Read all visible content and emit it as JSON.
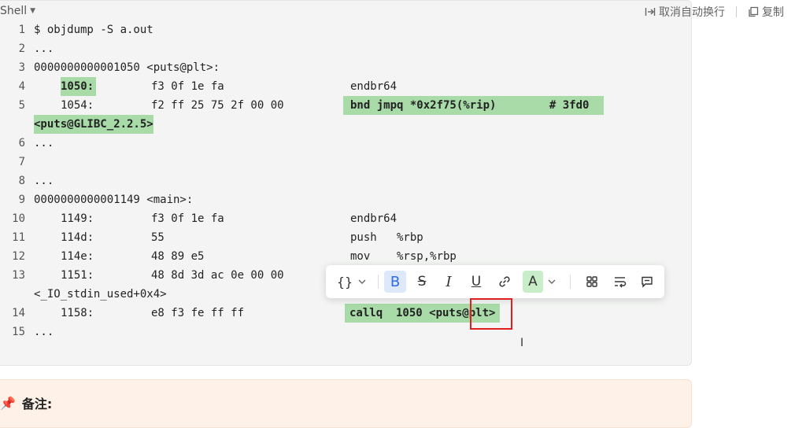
{
  "header": {
    "language": "Shell",
    "wrap_label": "取消自动换行",
    "copy_label": "复制"
  },
  "code_lines": [
    {
      "num": "1",
      "text": "$ objdump -S a.out"
    },
    {
      "num": "2",
      "text": "..."
    },
    {
      "num": "3",
      "text": "0000000000001050 <puts@plt>:"
    },
    {
      "num": "4",
      "addr": "1050:",
      "bytes": "f3 0f 1e fa",
      "asm": "endbr64"
    },
    {
      "num": "5",
      "addr": "1054:",
      "bytes": "f2 ff 25 75 2f 00 00",
      "asm": "bnd jmpq *0x2f75(%rip)        # 3fd0",
      "cont": "<puts@GLIBC_2.2.5>"
    },
    {
      "num": "6",
      "text": "..."
    },
    {
      "num": "7",
      "text": ""
    },
    {
      "num": "8",
      "text": "..."
    },
    {
      "num": "9",
      "text": "0000000000001149 <main>:"
    },
    {
      "num": "10",
      "addr": "1149:",
      "bytes": "f3 0f 1e fa",
      "asm": "endbr64"
    },
    {
      "num": "11",
      "addr": "114d:",
      "bytes": "55",
      "asm": "push   %rbp"
    },
    {
      "num": "12",
      "addr": "114e:",
      "bytes": "48 89 e5",
      "asm": "mov    %rsp,%rbp"
    },
    {
      "num": "13",
      "addr": "1151:",
      "bytes": "48 8d 3d ac 0e 00 00",
      "asm": "",
      "cont": "<_IO_stdin_used+0x4>"
    },
    {
      "num": "14",
      "addr": "1158:",
      "bytes": "e8 f3 fe ff ff",
      "asm": "callq  1050 <puts@plt>"
    },
    {
      "num": "15",
      "text": "..."
    }
  ],
  "toolbar": {
    "code_label": "{}",
    "bold_label": "B",
    "strike_label": "S",
    "italic_label": "I",
    "underline_label": "U",
    "color_label": "A"
  },
  "note": {
    "label": "备注:"
  },
  "colors": {
    "highlight": "#a8dba8",
    "block_bg": "#f3f4f3",
    "note_bg": "#fdf1e8",
    "red_box": "#e02020"
  }
}
